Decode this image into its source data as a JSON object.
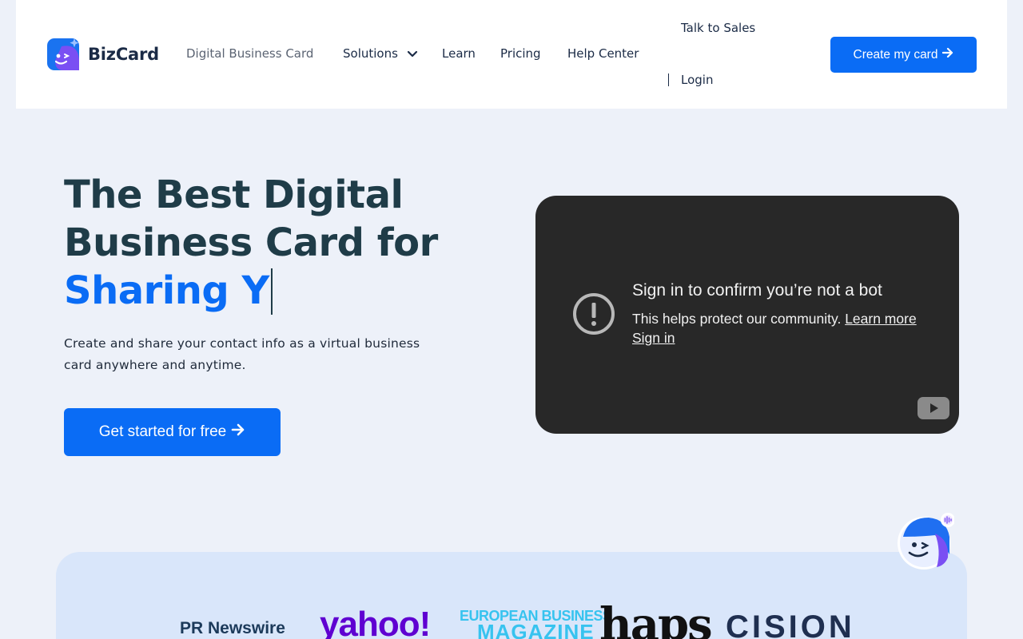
{
  "header": {
    "brand": "BizCard",
    "nav": {
      "digital_card": "Digital Business Card",
      "solutions": "Solutions",
      "learn": "Learn",
      "pricing": "Pricing",
      "help": "Help Center"
    },
    "talk_sales": "Talk to Sales",
    "login": "Login",
    "cta": "Create my card"
  },
  "hero": {
    "title_line1": "The Best Digital",
    "title_line2": "Business Card for",
    "title_accent": "Sharing Y",
    "subtitle": "Create and share your contact info as a virtual business card anywhere and anytime.",
    "cta": "Get started for free"
  },
  "video": {
    "title": "Sign in to confirm you’re not a bot",
    "message": "This helps protect our community.",
    "learn_more": "Learn more",
    "sign_in": "Sign in"
  },
  "press": {
    "prnewswire": "PR Newswire",
    "yahoo": "yahoo!",
    "ebm_line1": "EUROPEAN BUSINESS",
    "ebm_line2": "MAGAZINE",
    "haps": "haps",
    "cision": "CISION"
  },
  "colors": {
    "accent": "#0a6cf5",
    "heading": "#1f3c48",
    "background": "#edf1f9",
    "video_bg": "#282828"
  }
}
